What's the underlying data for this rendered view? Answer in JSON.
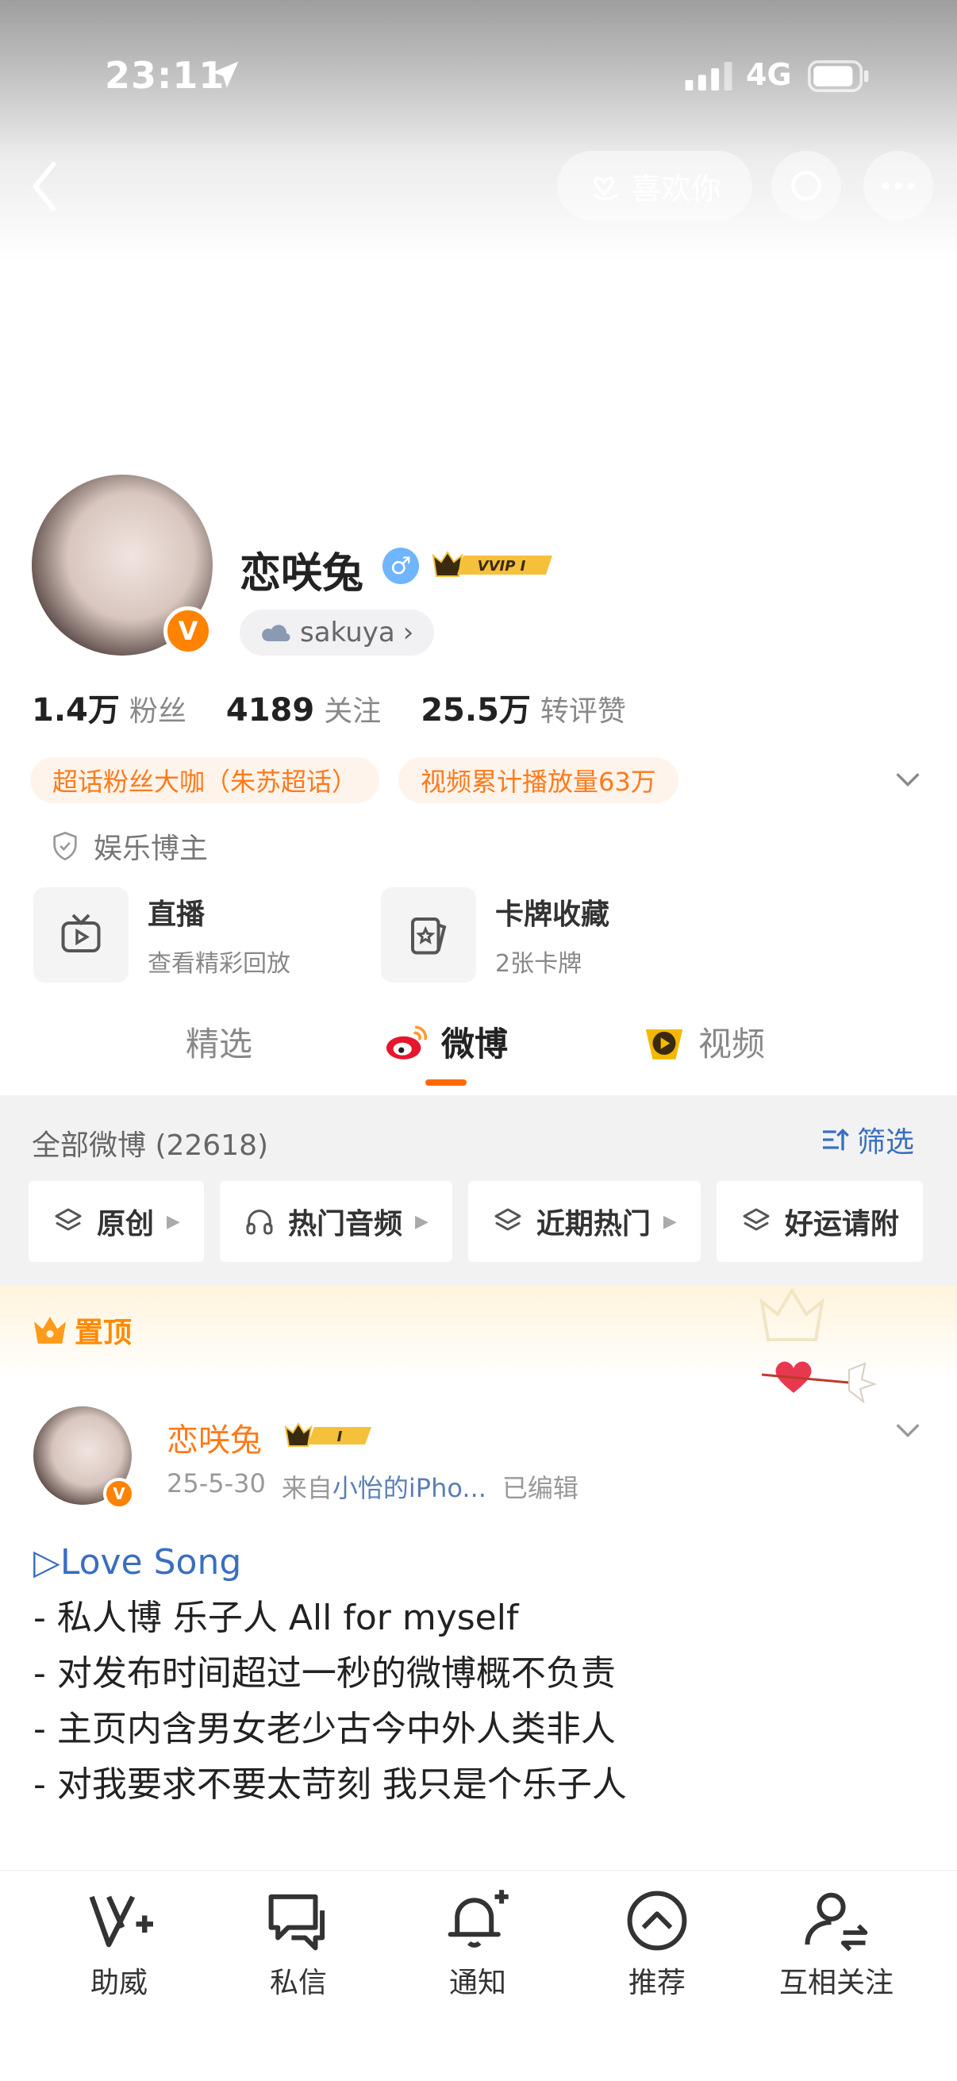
{
  "status_bar": {
    "time": "23:11",
    "network": "4G"
  },
  "top_nav": {
    "like_label": "喜欢你"
  },
  "profile": {
    "name": "恋咲兔",
    "gender_symbol": "♂",
    "vip_label": "VVIP I",
    "handle": "sakuya",
    "handle_chevron": "›",
    "stats": [
      {
        "value": "1.4万",
        "label": "粉丝"
      },
      {
        "value": "4189",
        "label": "关注"
      },
      {
        "value": "25.5万",
        "label": "转评赞"
      }
    ],
    "tags": [
      "超话粉丝大咖（朱苏超话）",
      "视频累计播放量63万"
    ],
    "role": "娱乐博主",
    "cards": [
      {
        "title": "直播",
        "subtitle": "查看精彩回放"
      },
      {
        "title": "卡牌收藏",
        "subtitle": "2张卡牌"
      }
    ]
  },
  "tabs": [
    {
      "label": "精选",
      "active": false
    },
    {
      "label": "微博",
      "active": true
    },
    {
      "label": "视频",
      "active": false
    }
  ],
  "feed": {
    "count_label": "全部微博 (22618)",
    "filter_label": "筛选",
    "chips": [
      "原创",
      "热门音频",
      "近期热门",
      "好运请附"
    ]
  },
  "pinned": {
    "label": "置顶"
  },
  "post": {
    "author": "恋咲兔",
    "vip_level": "I",
    "date": "25-5-30",
    "source_prefix": "来自",
    "source": "小怡的iPho...",
    "edited": "已编辑",
    "song": "▷Love Song",
    "lines": [
      "- 私人博 乐子人 All for myself",
      "- 对发布时间超过一秒的微博概不负责",
      "- 主页内含男女老少古今中外人类非人",
      "- 对我要求不要太苛刻 我只是个乐子人"
    ]
  },
  "bottom_nav": [
    {
      "label": "助威",
      "icon": "boost-v-icon"
    },
    {
      "label": "私信",
      "icon": "message-icon"
    },
    {
      "label": "通知",
      "icon": "bell-icon"
    },
    {
      "label": "推荐",
      "icon": "up-arrow-circle-icon"
    },
    {
      "label": "互相关注",
      "icon": "mutual-follow-icon"
    }
  ],
  "colors": {
    "accent": "#ff8200",
    "link": "#3a6fbf",
    "tag_text": "#ff7a1a"
  }
}
